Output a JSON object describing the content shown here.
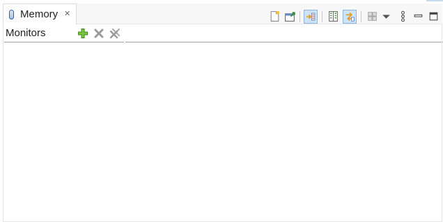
{
  "tab": {
    "title": "Memory",
    "close_glyph": "✕",
    "icon": "memory-icon"
  },
  "toolbar": {
    "icons": [
      "new-memory-view-icon",
      "pin-memory-icon",
      "link-memory-panes-icon",
      "toggle-split-pane-icon",
      "toggle-memory-monitors-icon",
      "layout-icon",
      "view-menu-dropdown-icon",
      "more-options-icon",
      "minimize-icon",
      "maximize-icon"
    ]
  },
  "monitors": {
    "label": "Monitors",
    "buttons": [
      "add-icon",
      "remove-icon",
      "remove-all-icon"
    ]
  },
  "colors": {
    "accent_blue": "#2a5fb0",
    "pressed_bg": "#cfe3f8",
    "add_green": "#4a9a1f",
    "remove_gray": "#9a9a9a"
  }
}
